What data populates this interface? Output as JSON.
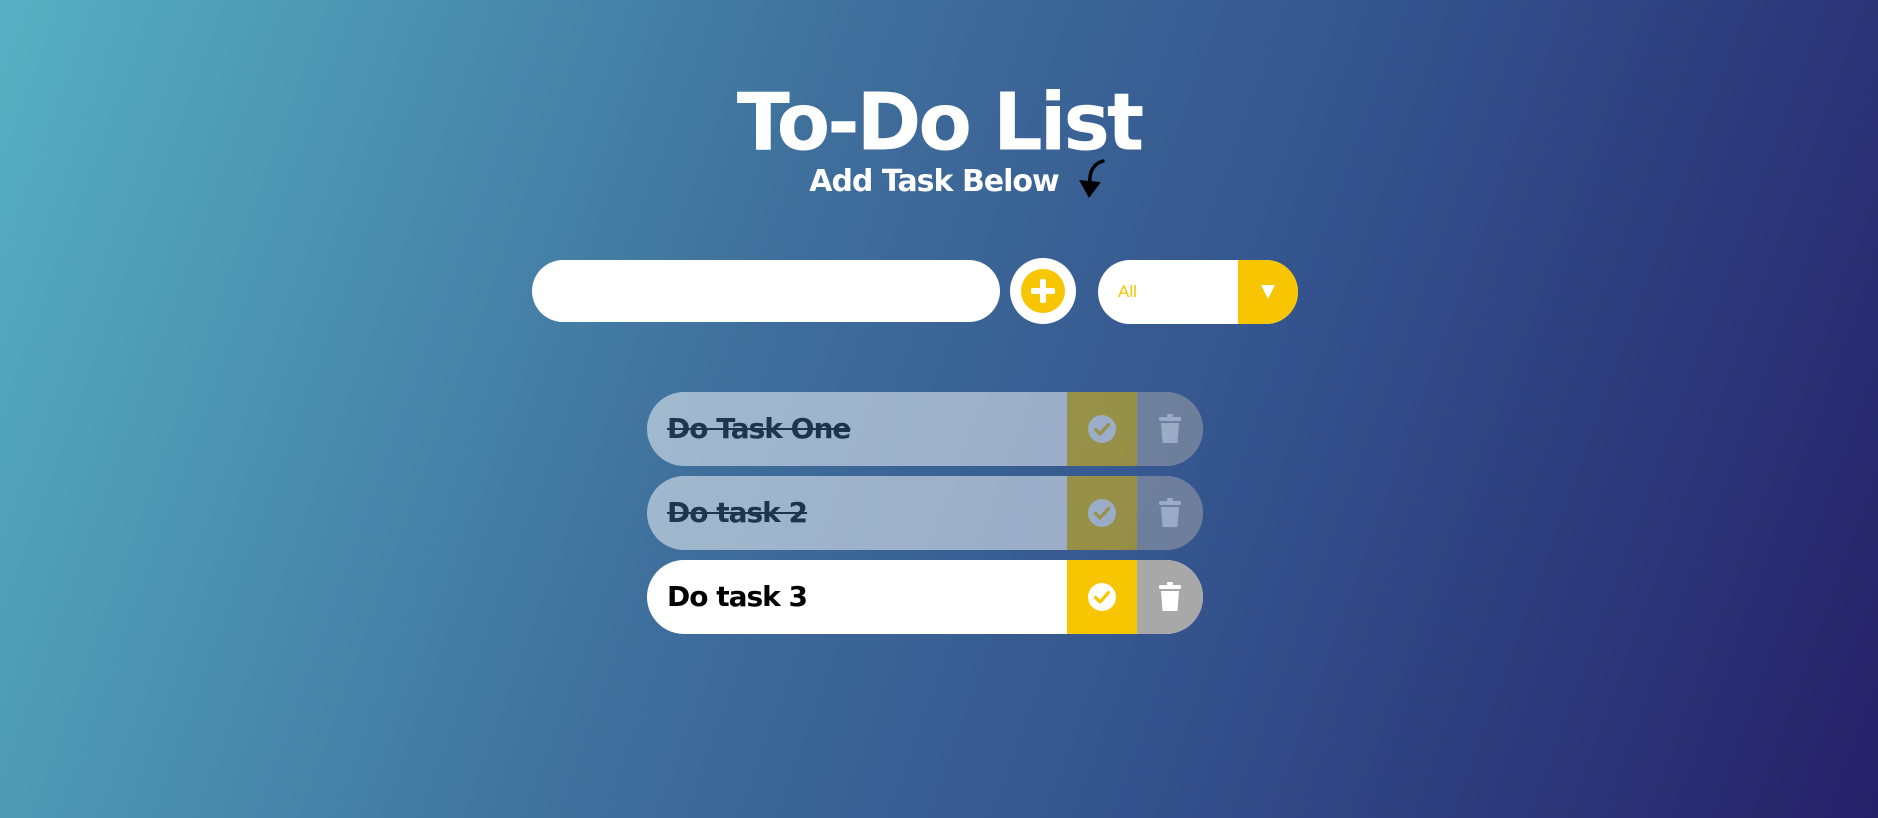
{
  "header": {
    "title": "To-Do List",
    "subtitle": "Add Task Below"
  },
  "form": {
    "input_value": "",
    "input_placeholder": "",
    "add_icon": "plus-circle-icon",
    "filter_selected": "All",
    "filter_toggle_icon": "chevron-down-icon"
  },
  "todos": [
    {
      "text": "Do Task One",
      "completed": true
    },
    {
      "text": "Do task 2",
      "completed": true
    },
    {
      "text": "Do task 3",
      "completed": false
    }
  ],
  "colors": {
    "accent": "#f7c600",
    "trash": "#a8a8a8",
    "item_bg": "#ffffff"
  }
}
